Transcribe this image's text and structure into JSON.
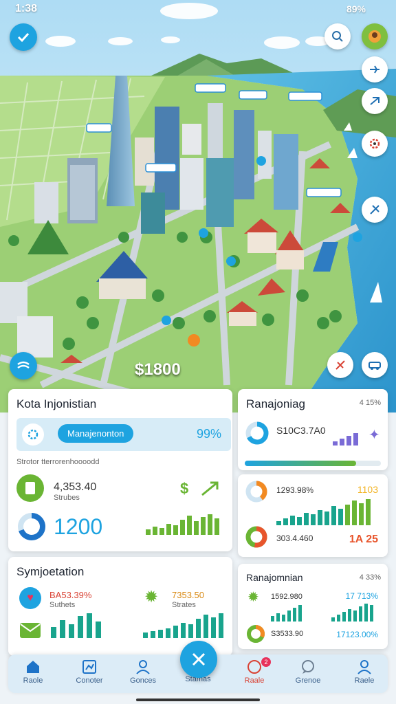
{
  "status": {
    "time": "1:38",
    "battery": "89%"
  },
  "map": {
    "price_label": "$1800"
  },
  "card_left_top": {
    "title": "Kota Injonistian",
    "row_button": "Manajenonton",
    "row_percent": "99%",
    "subtitle": "Strotor tterrorenhoooodd",
    "stat_value": "4,353.40",
    "stat_caption": "Strubes",
    "big_value": "1200"
  },
  "card_right_top": {
    "title": "Ranajoniag",
    "badge": "4 15%",
    "stat_value": "S10C3.7A0",
    "progress": 0.82
  },
  "card_right_mid": {
    "value_a": "1293.98%",
    "value_a_badge": "1103",
    "value_b": "303.4.460",
    "value_b_badge": "1A 25"
  },
  "card_left_bottom": {
    "title": "Symjoetation",
    "value_a": "BA53.39%",
    "value_a_caption": "Suthets",
    "value_b": "7353.50",
    "value_b_caption": "Strates"
  },
  "card_right_bottom": {
    "title": "Ranajomnian",
    "badge": "4 33%",
    "value_a": "1592.980",
    "value_a_badge": "17 713%",
    "value_b": "S3533.90",
    "value_b_badge": "17123.00%"
  },
  "nav": {
    "items": [
      "Raole",
      "Conoter",
      "Gonces",
      "Stamas",
      "Raale",
      "Grenoe",
      "Raele"
    ],
    "fab_icon": "close-icon",
    "badge_count": "2"
  },
  "colors": {
    "accent": "#1ea3e0",
    "green": "#6ab534",
    "orange": "#f28a22",
    "sky": "#bfe6f8",
    "sea": "#3aa9d6"
  }
}
